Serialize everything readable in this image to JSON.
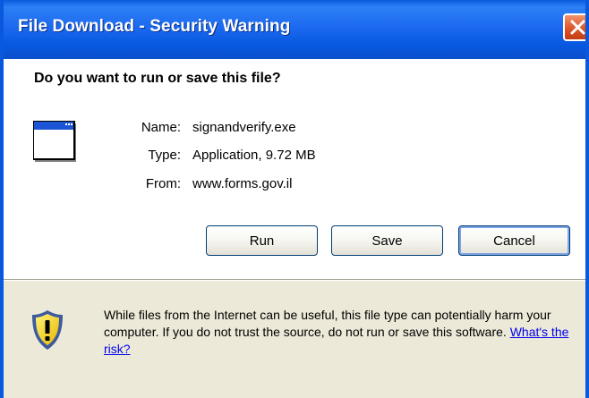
{
  "window": {
    "title": "File Download - Security Warning"
  },
  "dialog": {
    "question": "Do you want to run or save this file?",
    "fields": {
      "name_label": "Name:",
      "name_value": "signandverify.exe",
      "type_label": "Type:",
      "type_value": "Application, 9.72 MB",
      "from_label": "From:",
      "from_value": "www.forms.gov.il"
    },
    "buttons": {
      "run": "Run",
      "save": "Save",
      "cancel": "Cancel"
    },
    "warning": {
      "text": "While files from the Internet can be useful, this file type can potentially harm your computer. If you do not trust the source, do not run or save this software.",
      "link": "What's the risk?"
    }
  },
  "icons": {
    "close": "close-icon",
    "file": "application-window-icon",
    "warning": "shield-warning-icon"
  },
  "colors": {
    "titlebar": "#0A58DE",
    "close_button": "#DD5628",
    "default_button_focus": "#7DA2E6",
    "link": "#0000EE",
    "dialog_face": "#ECE9D8"
  }
}
